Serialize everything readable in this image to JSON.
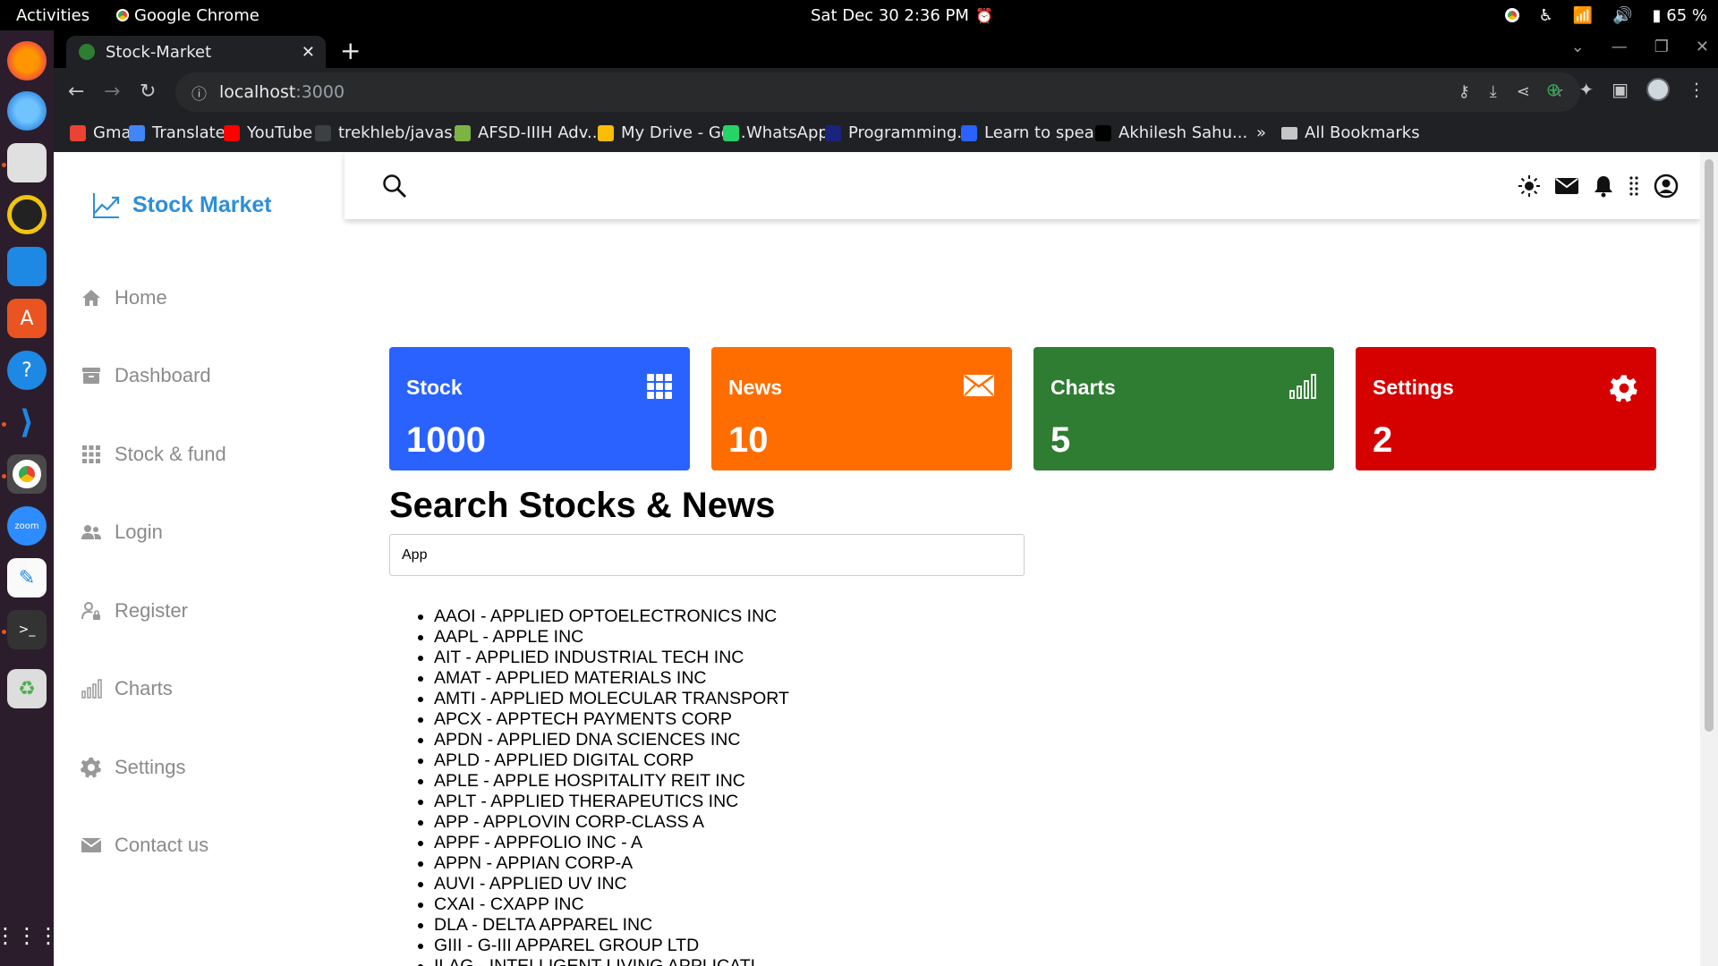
{
  "os": {
    "activities": "Activities",
    "app_name": "Google Chrome",
    "clock": "Sat Dec 30   2:36 PM",
    "battery": "65 %"
  },
  "browser": {
    "tab_title": "Stock-Market",
    "url_host": "localhost",
    "url_port": ":3000",
    "bookmarks": [
      {
        "label": "Gmail",
        "color": "#ea4335"
      },
      {
        "label": "Translate",
        "color": "#4285f4"
      },
      {
        "label": "YouTube",
        "color": "#ff0000"
      },
      {
        "label": "trekhleb/javas...",
        "color": "#3c4043"
      },
      {
        "label": "AFSD-IIIH Adv...",
        "color": "#7cb342"
      },
      {
        "label": "My Drive - Go...",
        "color": "#fbbc04"
      },
      {
        "label": "WhatsApp",
        "color": "#25d366"
      },
      {
        "label": "Programming...",
        "color": "#1a237e"
      },
      {
        "label": "Learn to spea...",
        "color": "#2962ff"
      },
      {
        "label": "Akhilesh Sahu...",
        "color": "#000000"
      }
    ],
    "more_bookmarks": "»",
    "all_bookmarks": "All Bookmarks"
  },
  "sidebar": {
    "brand": "Stock Market",
    "items": [
      {
        "label": "Home",
        "icon": "home-icon"
      },
      {
        "label": "Dashboard",
        "icon": "archive-icon"
      },
      {
        "label": "Stock & fund",
        "icon": "grid-icon"
      },
      {
        "label": "Login",
        "icon": "users-icon"
      },
      {
        "label": "Register",
        "icon": "user-lock-icon"
      },
      {
        "label": "Charts",
        "icon": "bar-chart-icon"
      },
      {
        "label": "Settings",
        "icon": "gear-icon"
      },
      {
        "label": "Contact us",
        "icon": "envelope-icon"
      }
    ]
  },
  "cards": [
    {
      "title": "Stock",
      "value": "1000",
      "color": "#2962ff",
      "icon": "grid-icon"
    },
    {
      "title": "News",
      "value": "10",
      "color": "#ff6d00",
      "icon": "envelope-icon"
    },
    {
      "title": "Charts",
      "value": "5",
      "color": "#2e7d32",
      "icon": "signal-icon"
    },
    {
      "title": "Settings",
      "value": "2",
      "color": "#d50000",
      "icon": "gear-icon"
    }
  ],
  "search": {
    "title": "Search Stocks & News",
    "value": "App"
  },
  "results": [
    "AAOI - APPLIED OPTOELECTRONICS INC",
    "AAPL - APPLE INC",
    "AIT - APPLIED INDUSTRIAL TECH INC",
    "AMAT - APPLIED MATERIALS INC",
    "AMTI - APPLIED MOLECULAR TRANSPORT",
    "APCX - APPTECH PAYMENTS CORP",
    "APDN - APPLIED DNA SCIENCES INC",
    "APLD - APPLIED DIGITAL CORP",
    "APLE - APPLE HOSPITALITY REIT INC",
    "APLT - APPLIED THERAPEUTICS INC",
    "APP - APPLOVIN CORP-CLASS A",
    "APPF - APPFOLIO INC - A",
    "APPN - APPIAN CORP-A",
    "AUVI - APPLIED UV INC",
    "CXAI - CXAPP INC",
    "DLA - DELTA APPAREL INC",
    "GIII - G-III APPAREL GROUP LTD",
    "ILAG - INTELLIGENT LIVING APPLICATI"
  ]
}
